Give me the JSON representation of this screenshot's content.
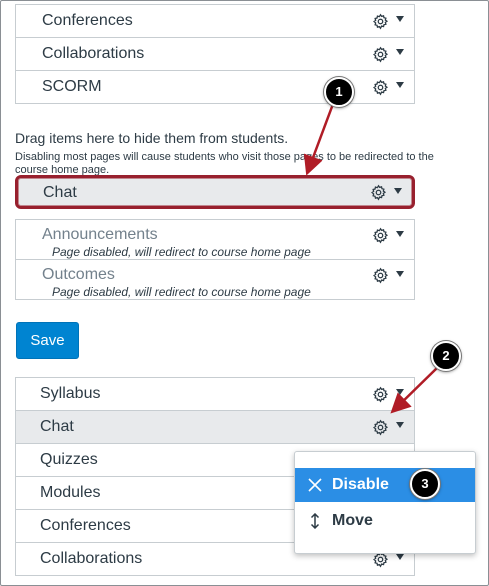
{
  "top_items": [
    {
      "label": "Conferences"
    },
    {
      "label": "Collaborations"
    },
    {
      "label": "SCORM"
    }
  ],
  "hidden_section": {
    "title": "Drag items here to hide them from students.",
    "subtitle": "Disabling most pages will cause students who visit those pages to be redirected to the course home page."
  },
  "dragged_item": {
    "label": "Chat"
  },
  "disabled_items": [
    {
      "label": "Announcements",
      "note": "Page disabled, will redirect to course home page"
    },
    {
      "label": "Outcomes",
      "note": "Page disabled, will redirect to course home page"
    }
  ],
  "save_label": "Save",
  "bottom_items": [
    {
      "label": "Syllabus"
    },
    {
      "label": "Chat"
    },
    {
      "label": "Quizzes"
    },
    {
      "label": "Modules"
    },
    {
      "label": "Conferences"
    },
    {
      "label": "Collaborations"
    }
  ],
  "menu": {
    "disable_label": "Disable",
    "move_label": "Move"
  },
  "callouts": {
    "one": "1",
    "two": "2",
    "three": "3"
  },
  "colors": {
    "accent_red": "#98202e",
    "save_blue": "#0084d1",
    "menu_highlight": "#2b8ee5",
    "callout_arrow": "#b01c26"
  }
}
